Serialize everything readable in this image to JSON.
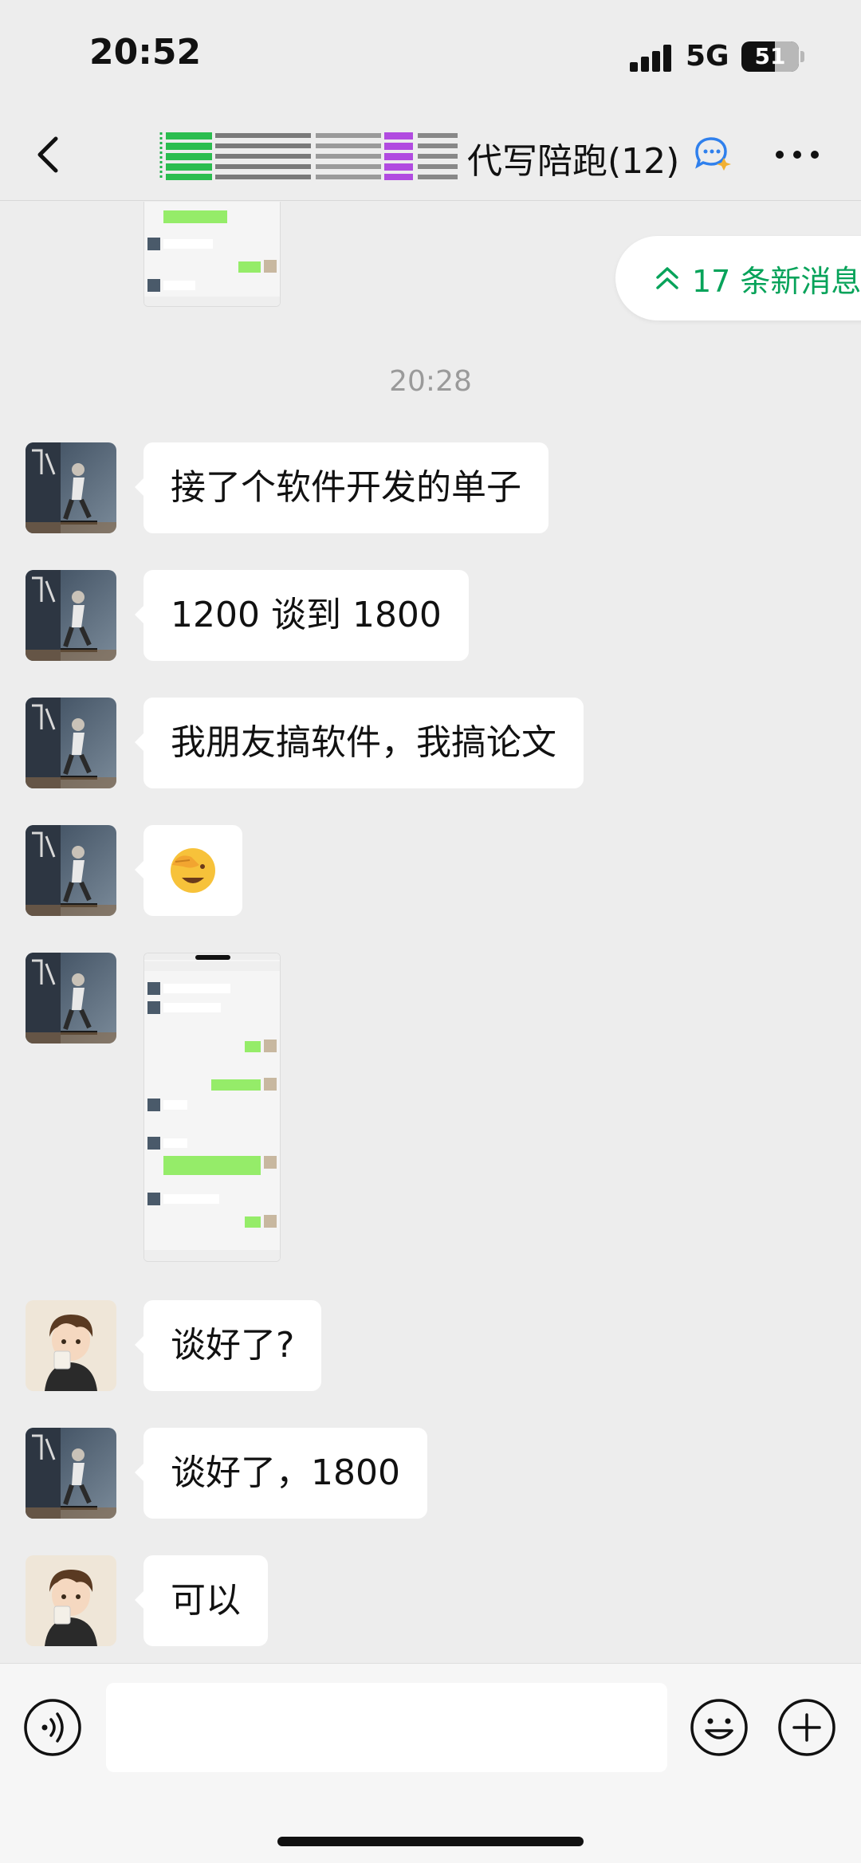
{
  "status_bar": {
    "time": "20:52",
    "network": "5G",
    "battery_level": "51"
  },
  "header": {
    "title": "代写陪跑(12)",
    "back_icon": "chevron-left-icon",
    "group_icon": "group-chat-icon",
    "more_icon": "more-dots-icon"
  },
  "new_messages": {
    "label": "17 条新消息",
    "icon": "double-chevron-up-icon"
  },
  "timestamp": "20:28",
  "messages": [
    {
      "sender": "friend",
      "type": "text",
      "text": "接了个软件开发的单子"
    },
    {
      "sender": "friend",
      "type": "text",
      "text": "1200 谈到 1800"
    },
    {
      "sender": "friend",
      "type": "text",
      "text": "我朋友搞软件，我搞论文"
    },
    {
      "sender": "friend",
      "type": "emoji",
      "emoji": "🤦"
    },
    {
      "sender": "friend",
      "type": "image",
      "description_icon": "chat-screenshot-image"
    },
    {
      "sender": "me",
      "type": "text",
      "text": "谈好了?"
    },
    {
      "sender": "friend",
      "type": "text",
      "text": "谈好了，1800"
    },
    {
      "sender": "me",
      "type": "text",
      "text": "可以"
    }
  ],
  "input_bar": {
    "voice_icon": "voice-icon",
    "emoji_icon": "emoji-icon",
    "plus_icon": "plus-icon",
    "input_value": ""
  },
  "colors": {
    "background": "#ededed",
    "accent_green": "#07a35a",
    "bubble": "#ffffff"
  }
}
